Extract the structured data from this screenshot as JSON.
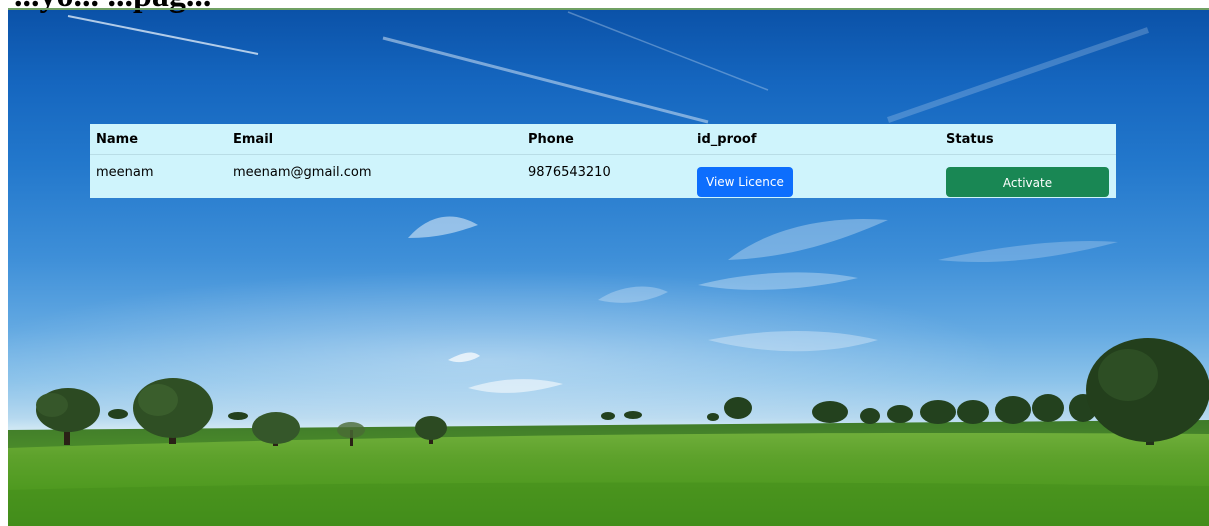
{
  "header": {
    "heading": "...yo... ...pag..."
  },
  "table": {
    "columns": [
      "Name",
      "Email",
      "Phone",
      "id_proof",
      "Status"
    ],
    "rows": [
      {
        "name": "meenam",
        "email": "meenam@gmail.com",
        "phone": "9876543210",
        "id_proof_button": "View Licence",
        "status_button": "Activate"
      }
    ]
  },
  "colors": {
    "table_background": "#cff4fc",
    "view_button": "#0d6efd",
    "activate_button": "#198754"
  },
  "background": {
    "icon": "landscape-image"
  }
}
